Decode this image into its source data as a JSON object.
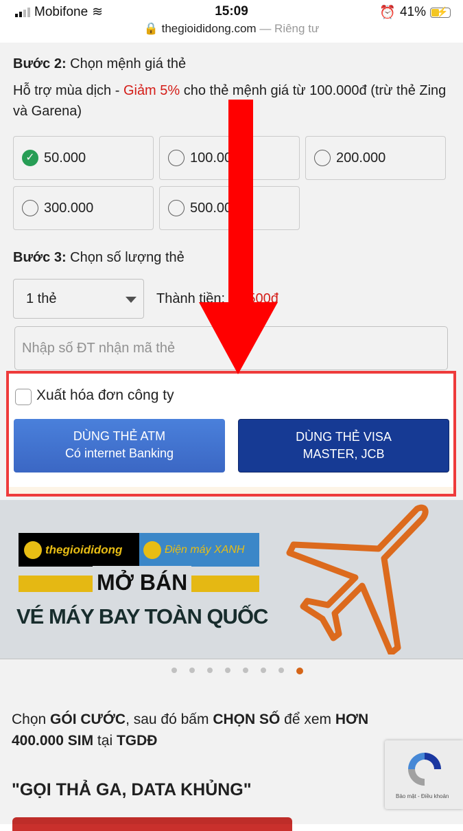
{
  "status_bar": {
    "carrier": "Mobifone",
    "time": "15:09",
    "battery": "41%",
    "battery_level": 0.41
  },
  "browser": {
    "domain": "thegioididong.com",
    "privacy": "— Riêng tư"
  },
  "step2": {
    "label": "Bước 2:",
    "text": " Chọn mệnh giá thẻ",
    "promo_prefix": "Hỗ trợ mùa dịch - ",
    "promo_highlight": "Giảm 5%",
    "promo_suffix": " cho thẻ mệnh giá từ 100.000đ (trừ thẻ Zing và Garena)",
    "options": [
      {
        "label": "50.000",
        "selected": true
      },
      {
        "label": "100.000",
        "selected": false
      },
      {
        "label": "200.000",
        "selected": false
      },
      {
        "label": "300.000",
        "selected": false
      },
      {
        "label": "500.000",
        "selected": false
      }
    ]
  },
  "step3": {
    "label": "Bước 3:",
    "text": " Chọn số lượng thẻ",
    "quantity": "1 thẻ",
    "total_label": "Thành tiền: ",
    "total_value": "48.500đ"
  },
  "phone": {
    "placeholder": "Nhập số ĐT nhận mã thẻ"
  },
  "invoice": {
    "label": "Xuất hóa đơn công ty",
    "checked": false
  },
  "buttons": {
    "atm_line1": "DÙNG THẺ ATM",
    "atm_line2": "Có internet Banking",
    "visa_line1": "DÙNG THẺ VISA",
    "visa_line2": "MASTER, JCB"
  },
  "banner": {
    "logo1": "thegioididong",
    "logo2": "Điện máy XANH",
    "headline": "MỞ BÁN",
    "subline": "VÉ MÁY BAY TOÀN QUỐC",
    "slides": 8,
    "active_slide": 8
  },
  "promo": {
    "p1": "Chọn ",
    "b1": "GÓI CƯỚC",
    "p2": ", sau đó bấm ",
    "b2": "CHỌN SỐ",
    "p3": " để xem ",
    "b3": "HƠN 400.000 SIM",
    "p4": " tại ",
    "b4": "TGDĐ"
  },
  "section_title": "\"GỌI THẢ GA, DATA KHỦNG\"",
  "recaptcha": {
    "text": "Bảo mật - Điều khoản"
  },
  "colors": {
    "accent_red": "#e0201b",
    "atm_blue": "#3b67c4",
    "visa_navy": "#163a94",
    "highlight_border": "#ee3b3b",
    "arrow": "#ff0000"
  }
}
